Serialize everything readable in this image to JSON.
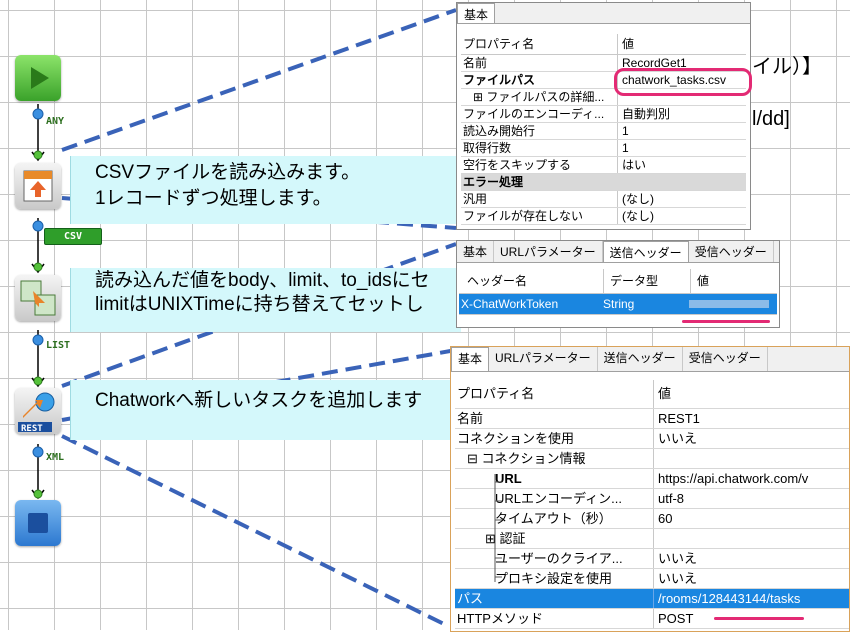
{
  "flow": {
    "ports": [
      {
        "label": "ANY"
      },
      {
        "label": "CSV"
      },
      {
        "label": "LIST"
      },
      {
        "label": "XML"
      }
    ],
    "notes": [
      {
        "line1": "CSVファイルを読み込みます。",
        "line2": "1レコードずつ処理します。"
      },
      {
        "line1": "読み込んだ値をbody、limit、to_idsにセ",
        "line2": "limitはUNIXTimeに持ち替えてセットし"
      },
      {
        "line1": "Chatworkへ新しいタスクを追加します",
        "line2": ""
      }
    ],
    "bg_text": {
      "a": "イル）】",
      "b": "l/dd]"
    }
  },
  "panel1": {
    "tab": "基本",
    "header": {
      "k": "プロパティ名",
      "v": "値"
    },
    "rows": [
      {
        "k": "名前",
        "v": "RecordGet1"
      },
      {
        "k": "ファイルパス",
        "v": "chatwork_tasks.csv"
      },
      {
        "k": "⊞ ファイルパスの詳細...",
        "v": ""
      },
      {
        "k": "ファイルのエンコーディ...",
        "v": "自動判別"
      },
      {
        "k": "読込み開始行",
        "v": "1"
      },
      {
        "k": "取得行数",
        "v": "1"
      },
      {
        "k": "空行をスキップする",
        "v": "はい"
      },
      {
        "k": "エラー処理",
        "v": ""
      },
      {
        "k": "汎用",
        "v": "(なし)"
      },
      {
        "k": "ファイルが存在しない",
        "v": "(なし)"
      }
    ]
  },
  "panel2": {
    "tabs": [
      "基本",
      "URLパラメーター",
      "送信ヘッダー",
      "受信ヘッダー"
    ],
    "columns": [
      "ヘッダー名",
      "データ型",
      "値"
    ],
    "row": {
      "name": "X-ChatWorkToken",
      "type": "String",
      "value": ""
    }
  },
  "panel3": {
    "tabs": [
      "基本",
      "URLパラメーター",
      "送信ヘッダー",
      "受信ヘッダー"
    ],
    "header": {
      "k": "プロパティ名",
      "v": "値"
    },
    "rows": [
      {
        "k": "名前",
        "v": "REST1"
      },
      {
        "k": "コネクションを使用",
        "v": "いいえ"
      },
      {
        "k": "⊟ コネクション情報",
        "v": ""
      },
      {
        "k": "URL",
        "v": "https://api.chatwork.com/v"
      },
      {
        "k": "URLエンコーディン...",
        "v": "utf-8"
      },
      {
        "k": "タイムアウト（秒）",
        "v": "60"
      },
      {
        "k": "⊞ 認証",
        "v": ""
      },
      {
        "k": "ユーザーのクライア...",
        "v": "いいえ"
      },
      {
        "k": "プロキシ設定を使用",
        "v": "いいえ"
      },
      {
        "k": "パス",
        "v": "/rooms/128443144/tasks"
      },
      {
        "k": "HTTPメソッド",
        "v": "POST"
      }
    ]
  },
  "colors": {
    "accent_pink": "#e32a74",
    "note_bg": "#d4f8fb",
    "select_blue": "#1a86e0",
    "dash_blue": "#3a63b8"
  }
}
